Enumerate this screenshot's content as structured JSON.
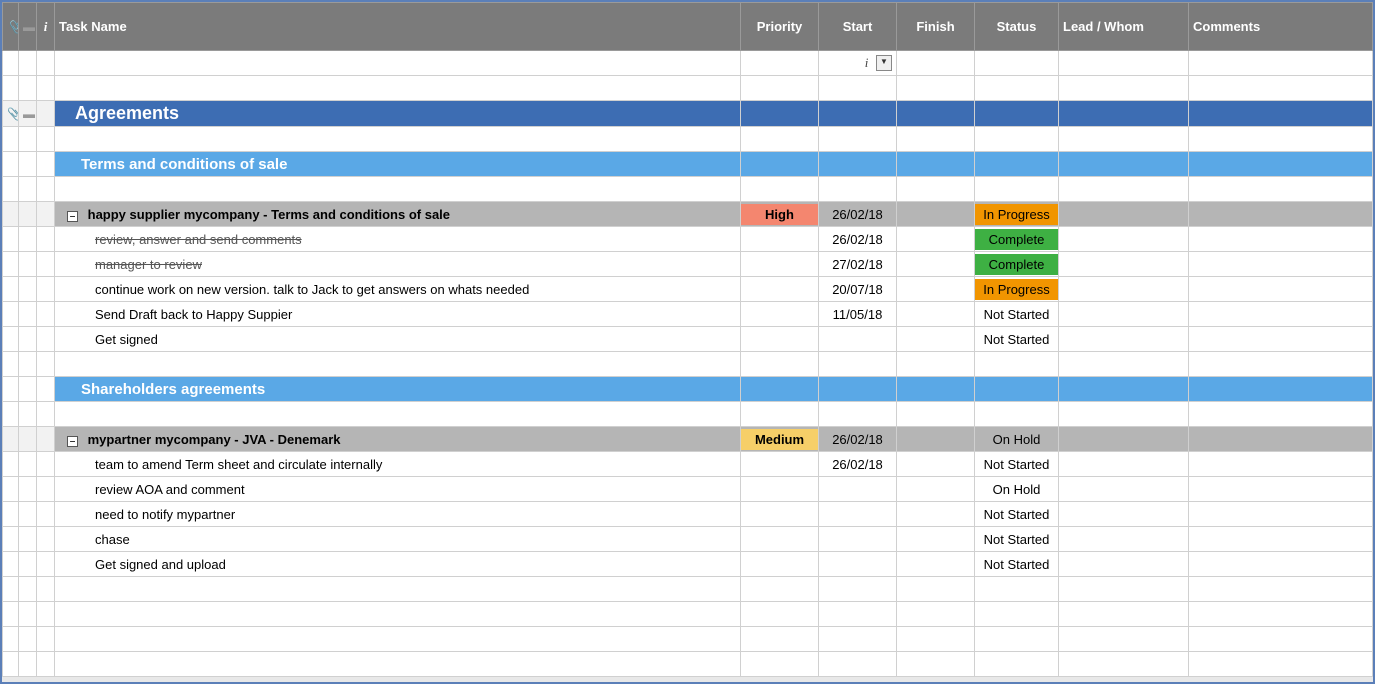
{
  "headers": {
    "attachment_icon": "📎",
    "note_icon": "▬",
    "info_icon": "i",
    "task": "Task Name",
    "priority": "Priority",
    "start": "Start",
    "finish": "Finish",
    "status": "Status",
    "lead": "Lead / Whom",
    "comments": "Comments"
  },
  "filter": {
    "start_hint": "i",
    "dropdown_glyph": "▼"
  },
  "section": {
    "title": "Agreements"
  },
  "sub1": {
    "title": "Terms and conditions of sale"
  },
  "group1": {
    "toggle": "–",
    "title": "happy supplier mycompany - Terms and conditions of sale",
    "priority": "High",
    "start": "26/02/18",
    "status": "In Progress"
  },
  "g1tasks": [
    {
      "name": "review, answer and send comments",
      "start": "26/02/18",
      "status": "Complete",
      "strike": true
    },
    {
      "name": "manager to review",
      "start": "27/02/18",
      "status": "Complete",
      "strike": true
    },
    {
      "name": "continue work on new version. talk to Jack to get answers on whats needed",
      "start": "20/07/18",
      "status": "In Progress"
    },
    {
      "name": "Send Draft back to Happy Suppier",
      "start": "11/05/18",
      "status": "Not Started"
    },
    {
      "name": "Get signed",
      "start": "",
      "status": "Not Started"
    }
  ],
  "sub2": {
    "title": "Shareholders agreements"
  },
  "group2": {
    "toggle": "–",
    "title": "mypartner mycompany - JVA - Denemark",
    "priority": "Medium",
    "start": "26/02/18",
    "status": "On Hold"
  },
  "g2tasks": [
    {
      "name": "team to amend Term sheet and circulate internally",
      "start": "26/02/18",
      "status": "Not Started"
    },
    {
      "name": "review AOA and comment",
      "start": "",
      "status": "On Hold"
    },
    {
      "name": "need to notify mypartner",
      "start": "",
      "status": "Not Started"
    },
    {
      "name": "chase",
      "start": "",
      "status": "Not Started"
    },
    {
      "name": "Get signed and upload",
      "start": "",
      "status": "Not Started"
    }
  ]
}
